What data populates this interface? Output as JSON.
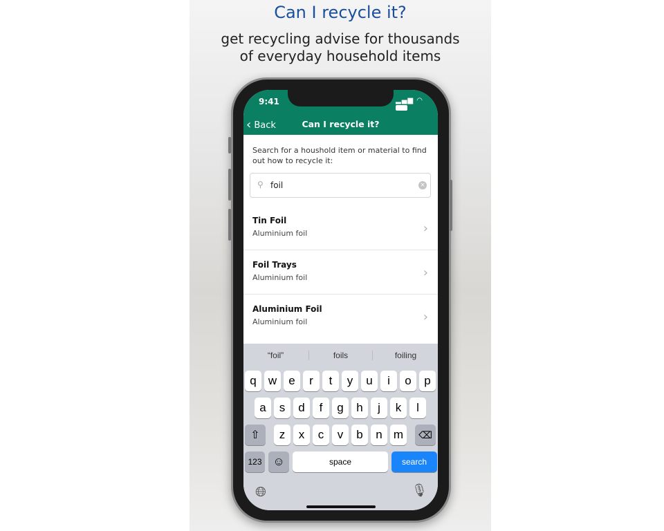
{
  "heading": "Can I recycle it?",
  "subheading_line1": "get recycling advise for thousands",
  "subheading_line2": "of everyday household items",
  "colors": {
    "nav": "#0b7f62",
    "heading": "#1a4f9c",
    "search_key": "#1a84fb"
  },
  "status": {
    "time": "9:41",
    "icons": [
      "signal-icon",
      "wifi-icon",
      "battery-icon"
    ]
  },
  "nav": {
    "back": "Back",
    "title": "Can I recycle it?"
  },
  "instruction": "Search for a houshold item or material to find out how to recycle it:",
  "search": {
    "value": "foil"
  },
  "results": [
    {
      "title": "Tin Foil",
      "subtitle": "Aluminium foil"
    },
    {
      "title": "Foil Trays",
      "subtitle": "Aluminium foil"
    },
    {
      "title": "Aluminium Foil",
      "subtitle": "Aluminium foil"
    }
  ],
  "keyboard": {
    "suggestions": [
      "“foil”",
      "foils",
      "foiling"
    ],
    "row1": [
      "q",
      "w",
      "e",
      "r",
      "t",
      "y",
      "u",
      "i",
      "o",
      "p"
    ],
    "row2": [
      "a",
      "s",
      "d",
      "f",
      "g",
      "h",
      "j",
      "k",
      "l"
    ],
    "row3": [
      "z",
      "x",
      "c",
      "v",
      "b",
      "n",
      "m"
    ],
    "numbers": "123",
    "space": "space",
    "search": "search"
  }
}
